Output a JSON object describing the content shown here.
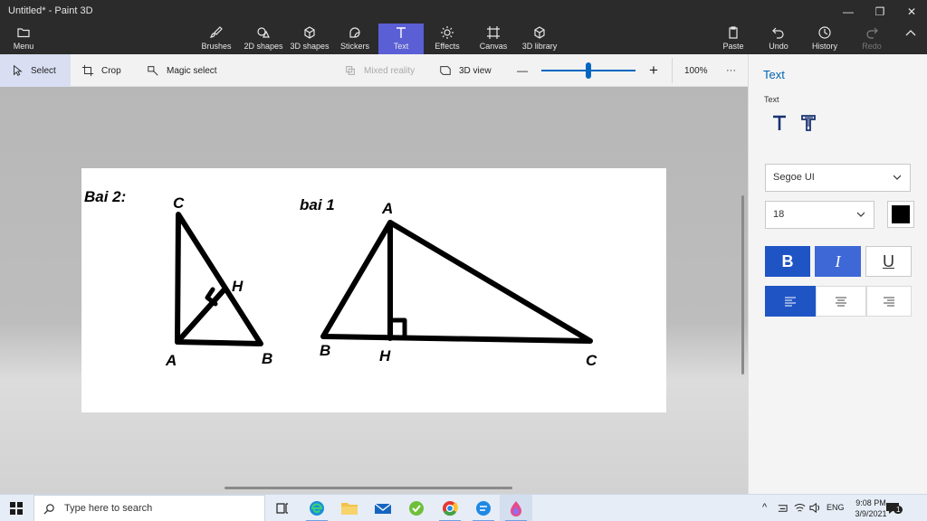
{
  "window": {
    "title": "Untitled* - Paint 3D"
  },
  "ribbon": {
    "menu": "Menu",
    "tools": [
      {
        "label": "Brushes",
        "icon": "brush-icon"
      },
      {
        "label": "2D shapes",
        "icon": "2d-shapes-icon"
      },
      {
        "label": "3D shapes",
        "icon": "3d-shapes-icon"
      },
      {
        "label": "Stickers",
        "icon": "stickers-icon"
      },
      {
        "label": "Text",
        "icon": "text-icon",
        "active": true
      },
      {
        "label": "Effects",
        "icon": "effects-icon"
      },
      {
        "label": "Canvas",
        "icon": "canvas-icon"
      },
      {
        "label": "3D library",
        "icon": "3d-library-icon"
      }
    ],
    "paste": "Paste",
    "undo": "Undo",
    "history": "History",
    "redo": "Redo"
  },
  "toolbar": {
    "select": "Select",
    "crop": "Crop",
    "magic_select": "Magic select",
    "mixed_reality": "Mixed reality",
    "view_3d": "3D view",
    "zoom_out": "—",
    "zoom_in": "+",
    "zoom": "100%",
    "more": "···",
    "zoom_level": 0.5
  },
  "canvas": {
    "labels": {
      "bai2": "Bai 2:",
      "bai1": "bai 1",
      "t2_c": "C",
      "t2_h": "H",
      "t2_a": "A",
      "t2_b": "B",
      "t1_a": "A",
      "t1_b": "B",
      "t1_h": "H",
      "t1_c": "C"
    }
  },
  "panel": {
    "title": "Text",
    "section": "Text",
    "font": "Segoe UI",
    "size": "18",
    "color": "#000000",
    "bold": "B",
    "italic": "I",
    "underline": "U"
  },
  "taskbar": {
    "search_placeholder": "Type here to search",
    "lang": "ENG",
    "time": "9:08 PM",
    "date": "3/9/2021",
    "notifications": "1"
  }
}
